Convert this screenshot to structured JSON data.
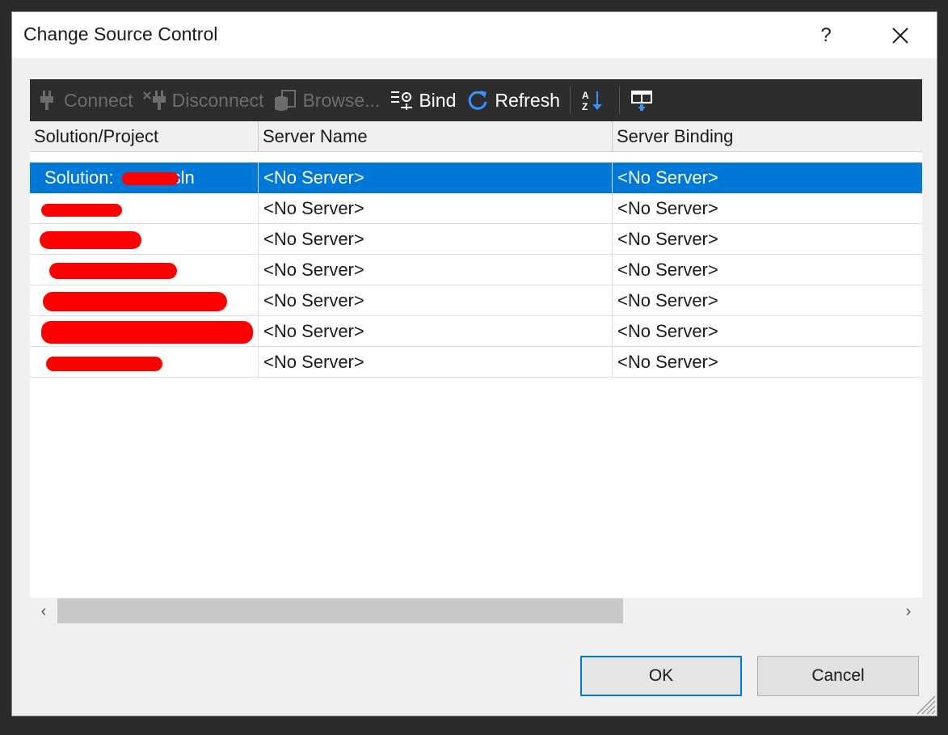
{
  "dialog": {
    "title": "Change Source Control",
    "help_label": "?",
    "close_icon": "close-icon"
  },
  "toolbar": {
    "buttons": [
      {
        "label": "Connect",
        "icon": "plug-icon",
        "enabled": false
      },
      {
        "label": "Disconnect",
        "icon": "unplug-icon",
        "enabled": false
      },
      {
        "label": "Browse...",
        "icon": "database-browse-icon",
        "enabled": false
      },
      {
        "label": "Bind",
        "icon": "bind-icon",
        "enabled": true
      },
      {
        "label": "Refresh",
        "icon": "refresh-icon",
        "enabled": true
      }
    ],
    "extra_icons": [
      "sort-az-icon",
      "column-options-icon"
    ]
  },
  "grid": {
    "columns": [
      "Solution/Project",
      "Server Name",
      "Server Binding"
    ],
    "rows": [
      {
        "project": "Solution:",
        "project_suffix": "sln",
        "server_name": "<No Server>",
        "server_binding": "<No Server>",
        "selected": true
      },
      {
        "project": "",
        "server_name": "<No Server>",
        "server_binding": "<No Server>",
        "selected": false
      },
      {
        "project": "",
        "server_name": "<No Server>",
        "server_binding": "<No Server>",
        "selected": false
      },
      {
        "project": "",
        "server_name": "<No Server>",
        "server_binding": "<No Server>",
        "selected": false
      },
      {
        "project": "",
        "server_name": "<No Server>",
        "server_binding": "<No Server>",
        "selected": false
      },
      {
        "project": "",
        "server_name": "<No Server>",
        "server_binding": "<No Server>",
        "selected": false
      },
      {
        "project": "",
        "server_name": "<No Server>",
        "server_binding": "<No Server>",
        "selected": false
      }
    ]
  },
  "scrollbar": {
    "left_arrow": "‹",
    "right_arrow": "›"
  },
  "buttons": {
    "ok": "OK",
    "cancel": "Cancel"
  },
  "colors": {
    "selection": "#0078d7",
    "toolbar_bg": "#2d2d30",
    "redaction": "#ff0000",
    "refresh_icon": "#3794ff"
  }
}
